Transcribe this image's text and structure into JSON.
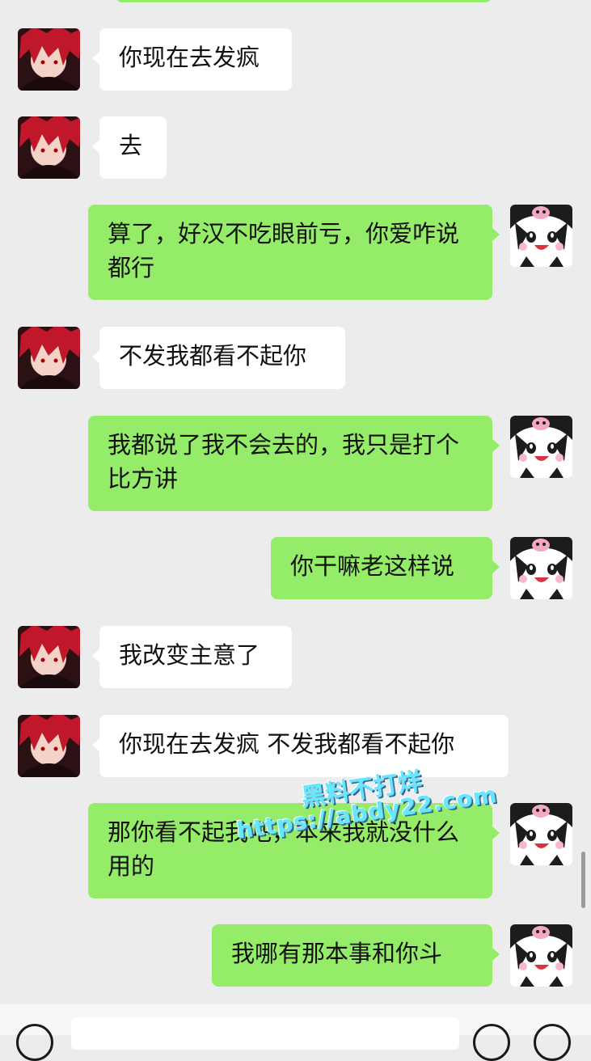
{
  "theme": {
    "background": "#ececec",
    "bubble_self": "#95ec69",
    "bubble_other": "#ffffff"
  },
  "messages": [
    {
      "side": "left",
      "text": "你现在去发疯"
    },
    {
      "side": "left",
      "text": "去"
    },
    {
      "side": "right",
      "text": "算了，好汉不吃眼前亏，你爱咋说都行"
    },
    {
      "side": "left",
      "text": "不发我都看不起你"
    },
    {
      "side": "right",
      "text": "我都说了我不会去的，我只是打个比方讲"
    },
    {
      "side": "right",
      "text": "你干嘛老这样说"
    },
    {
      "side": "left",
      "text": "我改变主意了"
    },
    {
      "side": "left",
      "text": "你现在去发疯 不发我都看不起你"
    },
    {
      "side": "right",
      "text": "那你看不起我吧，本来我就没什么用的"
    },
    {
      "side": "right",
      "text": "我哪有那本事和你斗"
    }
  ],
  "watermark": {
    "line1": "黑料不打烊",
    "line2": "https://abdy22.com"
  },
  "icons": {
    "left_avatar": "red-haired-anime-avatar",
    "right_avatar": "kuromi-avatar",
    "voice": "voice-icon",
    "emoji": "emoji-icon",
    "plus": "plus-icon"
  }
}
